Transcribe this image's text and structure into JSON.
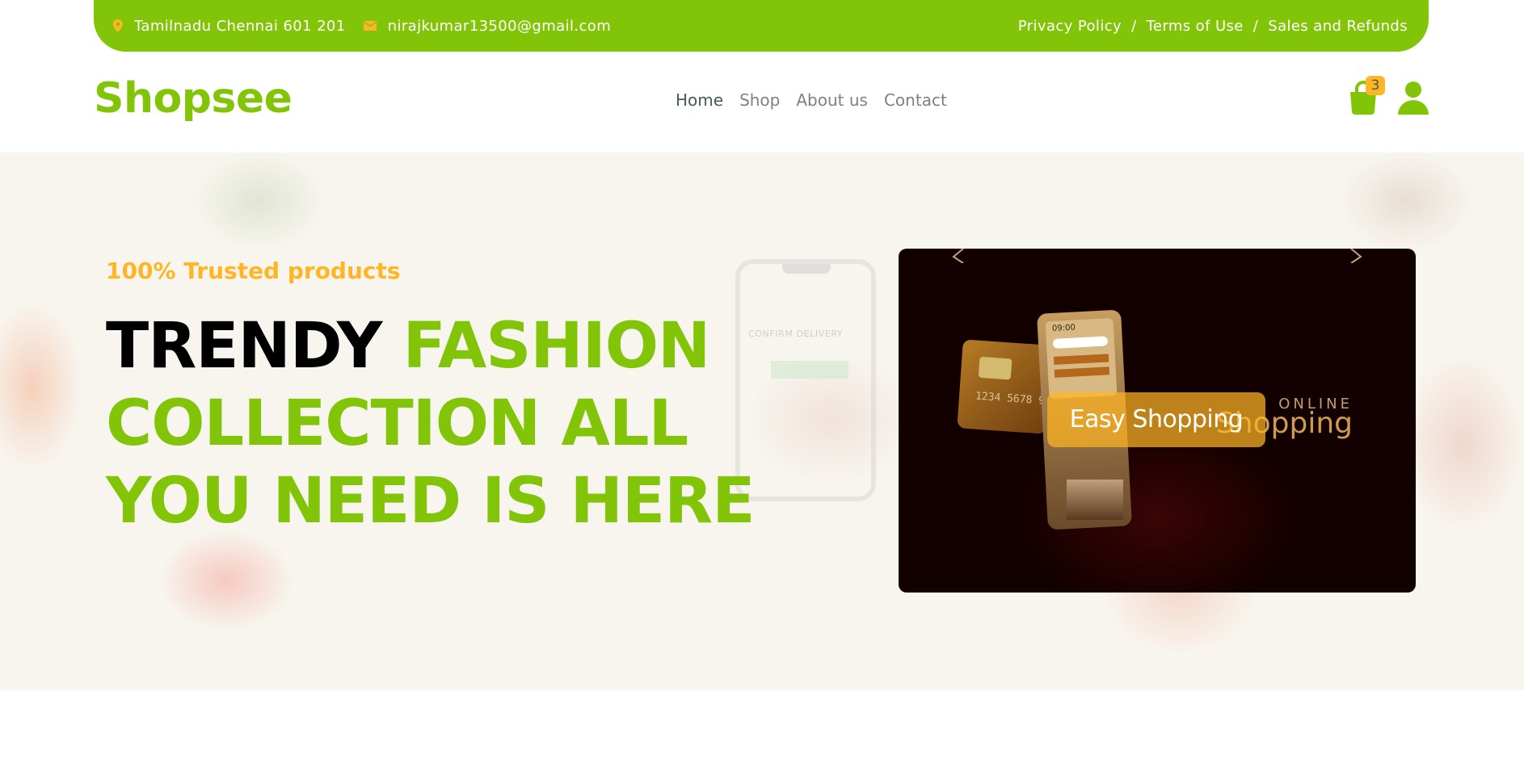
{
  "topbar": {
    "address": "Tamilnadu Chennai 601 201",
    "email": "nirajkumar13500@gmail.com",
    "links": [
      "Privacy Policy",
      "Terms of Use",
      "Sales and Refunds"
    ],
    "separator": "/"
  },
  "brand": "Shopsee",
  "nav": {
    "items": [
      "Home",
      "Shop",
      "About us",
      "Contact"
    ],
    "active": "Home"
  },
  "cart": {
    "count": "3"
  },
  "hero": {
    "tagline": "100% Trusted products",
    "headline_dark": "TRENDY",
    "headline_accent": " FASHION COLLECTION ALL YOU NEED IS HERE",
    "background_phone_text": "CONFIRM DELIVERY",
    "carousel": {
      "caption": "Easy Shopping",
      "image_text_online": "ONLINE",
      "image_text_shopping": "Shopping",
      "card_number": "1234 5678 90",
      "phone_time": "09:00"
    }
  },
  "colors": {
    "primary": "#81c408",
    "secondary": "#ffb524",
    "text_dark": "#45595b",
    "muted": "#808080"
  },
  "icons": {
    "address": "map-marker-icon",
    "email": "envelope-icon",
    "cart": "shopping-bag-icon",
    "user": "user-icon",
    "prev": "chevron-left-icon",
    "next": "chevron-right-icon"
  }
}
